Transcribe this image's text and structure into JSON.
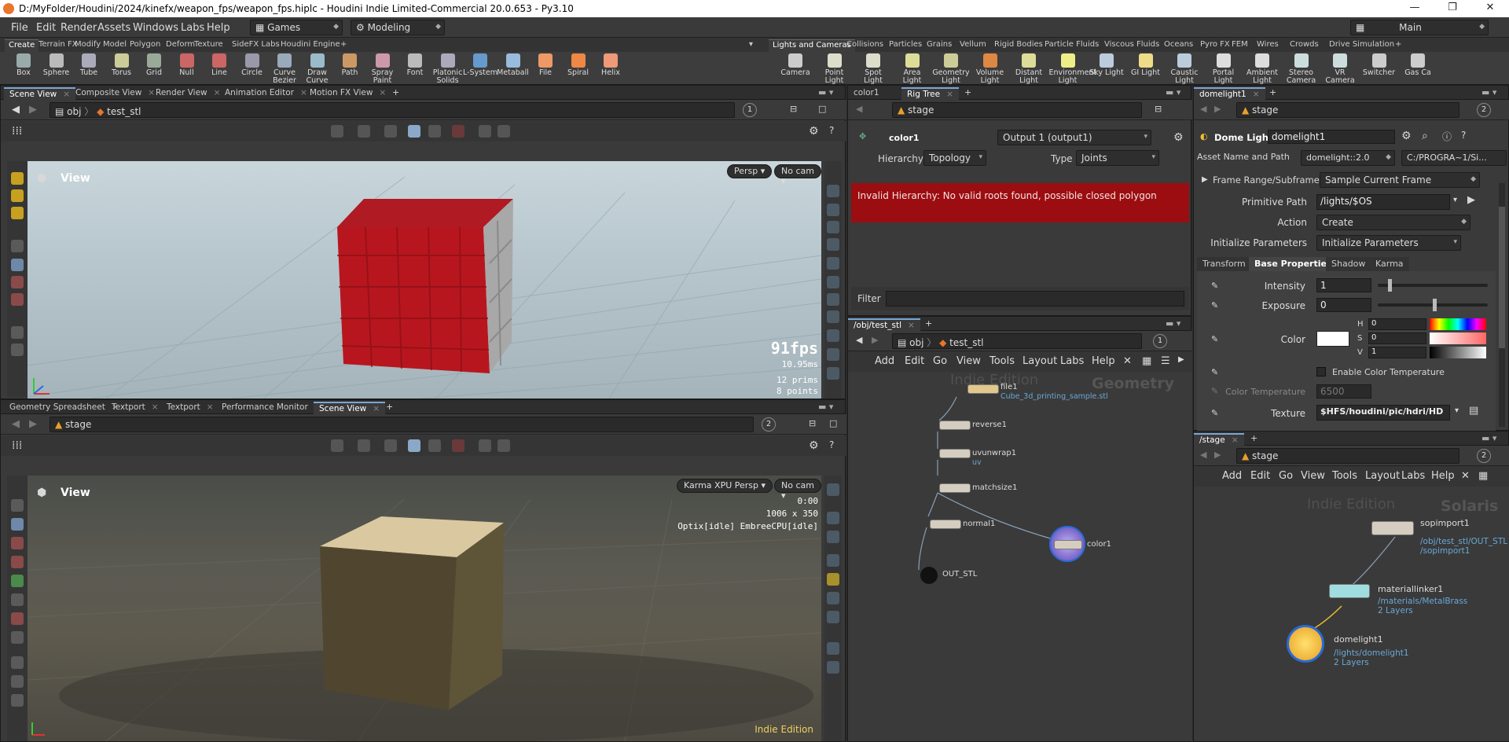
{
  "window": {
    "title": "D:/MyFolder/Houdini/2024/kinefx/weapon_fps/weapon_fps.hiplc - Houdini Indie Limited-Commercial 20.0.653 - Py3.10",
    "controls": {
      "minimize": "—",
      "maximize": "❐",
      "close": "✕"
    }
  },
  "menu": {
    "items": [
      "File",
      "Edit",
      "Render",
      "Assets",
      "Windows",
      "Labs",
      "Help"
    ],
    "desktop_left": "Games",
    "desktop_mid": "Modeling",
    "desktop_right": "Main"
  },
  "shelf": {
    "tabs_left": [
      "Create",
      "Terrain FX",
      "Modify",
      "Model",
      "Polygon",
      "Deform",
      "Texture",
      "SideFX Labs",
      "Houdini Engine"
    ],
    "tabs_right": [
      "Lights and Cameras",
      "Collisions",
      "Particles",
      "Grains",
      "Vellum",
      "Rigid Bodies",
      "Particle Fluids",
      "Viscous Fluids",
      "Oceans",
      "Pyro FX",
      "FEM",
      "Wires",
      "Crowds",
      "Drive Simulation"
    ],
    "tools_left": [
      "Box",
      "Sphere",
      "Tube",
      "Torus",
      "Grid",
      "Null",
      "Line",
      "Circle",
      "Curve Bezier",
      "Draw Curve",
      "Path",
      "Spray Paint",
      "Font",
      "Platonic Solids",
      "L-System",
      "Metaball",
      "File",
      "Spiral",
      "Helix"
    ],
    "tools_right": [
      "Camera",
      "Point Light",
      "Spot Light",
      "Area Light",
      "Geometry Light",
      "Volume Light",
      "Distant Light",
      "Environment Light",
      "Sky Light",
      "GI Light",
      "Caustic Light",
      "Portal Light",
      "Ambient Light",
      "Stereo Camera",
      "VR Camera",
      "Switcher",
      "Gas Ca"
    ]
  },
  "scene_top": {
    "tabs": [
      "Scene View",
      "Composite View",
      "Render View",
      "Animation Editor",
      "Motion FX View"
    ],
    "path_root": "obj",
    "path_node": "test_stl",
    "badge": "1",
    "view_label": "View",
    "persp": "Persp",
    "cam": "No cam",
    "fps": "91fps",
    "ms": "10.95ms",
    "prims": "12  prims",
    "points": "8 points"
  },
  "scene_bottom": {
    "tabs": [
      "Geometry Spreadsheet",
      "Textport",
      "Textport",
      "Performance Monitor",
      "Scene View"
    ],
    "path": "stage",
    "badge": "2",
    "view_label": "View",
    "persp": "Karma XPU Persp",
    "cam": "No cam",
    "time": "0:00",
    "res": "1006 x 350",
    "renderer": "Optix[idle] EmbreeCPU[idle]",
    "edition": "Indie Edition"
  },
  "rig_tree": {
    "tabs": [
      "color1",
      "Rig Tree"
    ],
    "path": "stage",
    "node_name": "color1",
    "output": "Output 1 (output1)",
    "hierarchy_label": "Hierarchy",
    "hierarchy_value": "Topology",
    "type_label": "Type",
    "type_value": "Joints",
    "error": "Invalid Hierarchy: No valid roots found, possible closed polygon",
    "filter_label": "Filter"
  },
  "net_obj": {
    "tab": "/obj/test_stl",
    "path_root": "obj",
    "path_node": "test_stl",
    "badge": "1",
    "menus": [
      "Add",
      "Edit",
      "Go",
      "View",
      "Tools",
      "Layout",
      "Labs",
      "Help"
    ],
    "watermark": "Indie Edition",
    "context": "Geometry",
    "nodes": {
      "file1": "file1",
      "file1_sub": "Cube_3d_printing_sample.stl",
      "reverse1": "reverse1",
      "uvunwrap1": "uvunwrap1",
      "uvunwrap1_sub": "uv",
      "matchsize1": "matchsize1",
      "normal1": "normal1",
      "color1": "color1",
      "out": "OUT_STL"
    }
  },
  "params": {
    "tab": "domelight1",
    "path": "stage",
    "badge": "2",
    "type": "Dome Light",
    "name": "domelight1",
    "asset_label": "Asset Name and Path",
    "asset_value": "domelight::2.0",
    "asset_path": "C:/PROGRA~1/Si...",
    "frame_label": "Frame Range/Subframes",
    "frame_value": "Sample Current Frame",
    "prim_label": "Primitive Path",
    "prim_value": "/lights/$OS",
    "action_label": "Action",
    "action_value": "Create",
    "init_label": "Initialize Parameters",
    "init_value": "Initialize Parameters",
    "tabs": [
      "Transform",
      "Base Properties",
      "Shadow",
      "Karma"
    ],
    "intensity_label": "Intensity",
    "intensity_value": "1",
    "intensity_level": 0.09,
    "exposure_label": "Exposure",
    "exposure_value": "0",
    "exposure_level": 0.5,
    "color_label": "Color",
    "h_label": "H",
    "h_value": "0",
    "s_label": "S",
    "s_value": "0",
    "v_label": "V",
    "v_value": "1",
    "enable_ct": "Enable Color Temperature",
    "ct_label": "Color Temperature",
    "ct_value": "6500",
    "texture_label": "Texture",
    "texture_value": "$HFS/houdini/pic/hdri/HD"
  },
  "net_stage": {
    "tab": "/stage",
    "path": "stage",
    "badge": "2",
    "menus": [
      "Add",
      "Edit",
      "Go",
      "View",
      "Tools",
      "Layout",
      "Labs",
      "Help"
    ],
    "watermark": "Indie Edition",
    "context": "Solaris",
    "nodes": {
      "sopimport1": "sopimport1",
      "sopimport1_sub": "/obj/test_stl/OUT_STL",
      "sopimport1_sub2": "/sopimport1",
      "materiallinker1": "materiallinker1",
      "materiallinker1_sub": "/materials/MetalBrass",
      "materiallinker1_sub2": "2 Layers",
      "domelight1": "domelight1",
      "domelight1_sub": "/lights/domelight1",
      "domelight1_sub2": "2 Layers"
    }
  },
  "colors": {
    "accent": "#7aa6d6",
    "error": "#9b0d10",
    "node_link": "#6aa8d6"
  }
}
